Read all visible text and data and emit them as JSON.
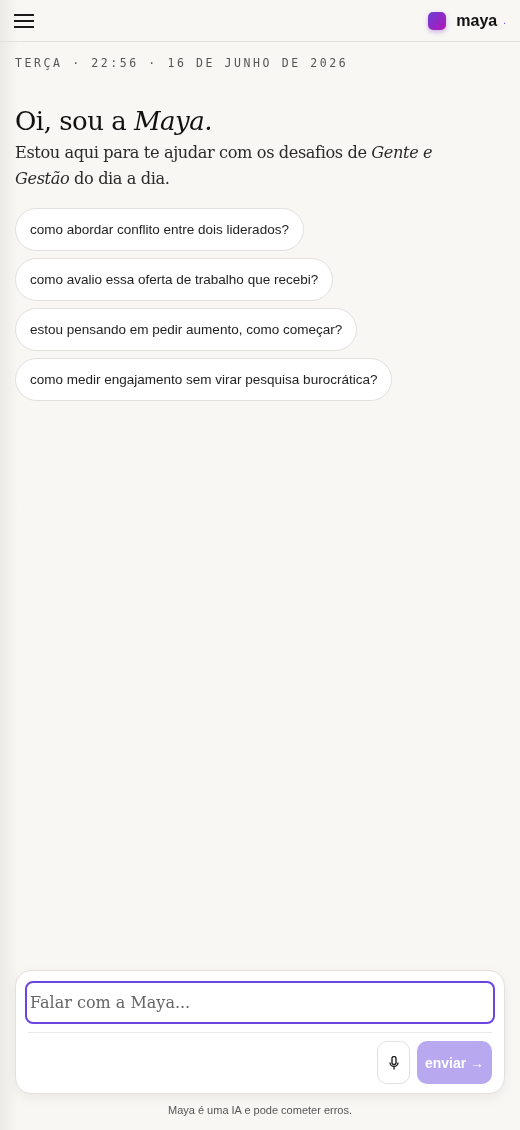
{
  "header": {
    "brand": "maya",
    "brand_suffix": "."
  },
  "dateline": "TERÇA · 22:56 · 16 DE JUNHO DE 2026",
  "greeting": {
    "title": "Oi, sou a *Maya.*",
    "subtitle": "Estou aqui para te ajudar com os desafios de *Gente e Gestão* do dia a dia."
  },
  "suggestions": [
    "como abordar conflito entre dois liderados?",
    "como avalio essa oferta de trabalho que recebi?",
    "estou pensando em pedir aumento, como começar?",
    "como medir engajamento sem virar pesquisa burocrática?"
  ],
  "composer": {
    "placeholder": "Falar com a Maya...",
    "send": {
      "label": "enviar →",
      "disabled": true
    }
  },
  "disclaimer": "Maya é uma IA e pode cometer erros."
}
